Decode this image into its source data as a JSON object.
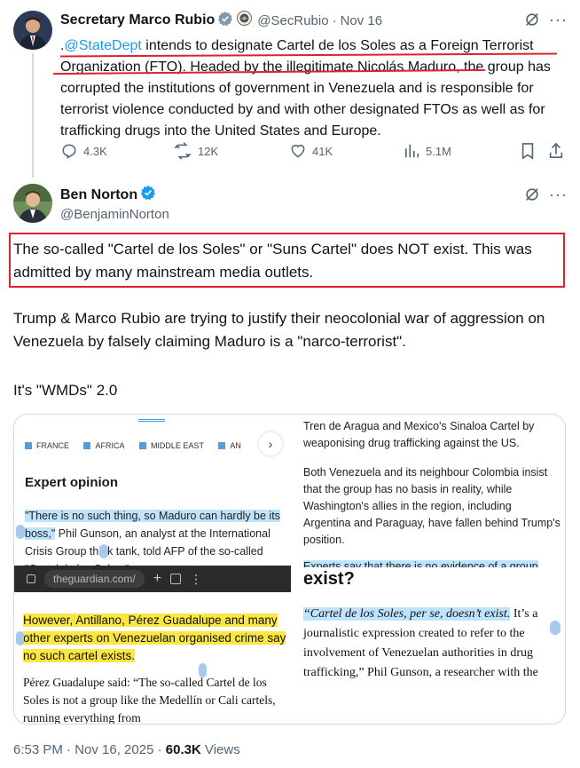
{
  "quoted_tweet": {
    "author_name": "Secretary Marco Rubio",
    "handle": "@SecRubio",
    "separator": "·",
    "date": "Nov 16",
    "text_prefix": ".",
    "mention": "@StateDept",
    "text_body": " intends to designate Cartel de los Soles as a Foreign Terrorist Organization (FTO). Headed by the illegitimate Nicolás Maduro, the group has corrupted the institutions of government in Venezuela and is responsible for terrorist violence conducted by and with other designated FTOs as well as for trafficking drugs into the United States and Europe.",
    "replies": "4.3K",
    "reposts": "12K",
    "likes": "41K",
    "views": "5.1M"
  },
  "main_tweet": {
    "author_name": "Ben Norton",
    "handle": "@BenjaminNorton",
    "highlighted_text": "The so-called \"Cartel de los Soles\" or \"Suns Cartel\" does NOT exist. This was admitted by many mainstream media outlets.",
    "paragraph_2": "Trump & Marco Rubio are trying to justify their neocolonial war of aggression on Venezuela by falsely claiming Maduro is a \"narco-terrorist\".",
    "paragraph_3": "It's \"WMDs\" 2.0",
    "timestamp": "6:53 PM · Nov 16, 2025 · ",
    "view_count": "60.3K",
    "views_label": " Views"
  },
  "media": {
    "nav_items": [
      "FRANCE",
      "AFRICA",
      "MIDDLE EAST",
      "AN"
    ],
    "left_heading": "Expert opinion",
    "left_quote_hl": "\"There is no such thing, so Maduro can hardly be its boss,\"",
    "left_quote_rest": " Phil Gunson, an analyst at the International Crisis Group think tank, told AFP of the so-called \"Cartel de los Soles.\"",
    "url_bar": "theguardian.com/",
    "left_yellow": "However, Antillano, Pérez Guadalupe and many other experts on Venezuelan organised crime say no such cartel exists.",
    "left_bottom": "Pérez Guadalupe said: “The so-called Cartel de los Soles is not a group like the Medellín or Cali cartels, running everything from",
    "right_top_1": "Tren de Aragua and Mexico's Sinaloa Cartel by weaponising drug trafficking against the US.",
    "right_top_2": "Both Venezuela and its neighbour Colombia insist that the group has no basis in reality, while Washington's allies in the region, including Argentina and Paraguay, have fallen behind Trump's position.",
    "right_top_3": "Experts say that there is no evidence of a group",
    "right_heading": "exist?",
    "right_hl": "“Cartel de los Soles, per se, doesn’t exist.",
    "right_rest": " It’s a journalistic expression created to refer to the involvement of Venezuelan authorities in drug trafficking,” Phil Gunson, a researcher with the"
  },
  "colors": {
    "accent_blue": "#1d9bf0",
    "highlight_red": "#e0202a",
    "highlight_yellow": "#fbe741",
    "highlight_blue": "#bfe3fb"
  }
}
